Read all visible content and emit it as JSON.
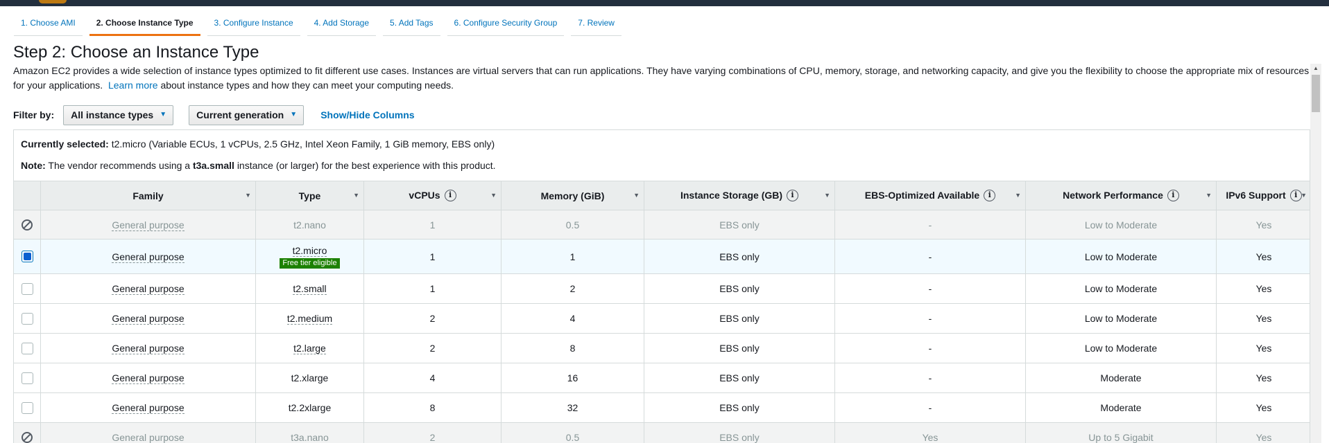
{
  "wizard": {
    "steps": [
      {
        "label": "1. Choose AMI"
      },
      {
        "label": "2. Choose Instance Type"
      },
      {
        "label": "3. Configure Instance"
      },
      {
        "label": "4. Add Storage"
      },
      {
        "label": "5. Add Tags"
      },
      {
        "label": "6. Configure Security Group"
      },
      {
        "label": "7. Review"
      }
    ],
    "active_index": 1
  },
  "page": {
    "title": "Step 2: Choose an Instance Type",
    "intro_part1": "Amazon EC2 provides a wide selection of instance types optimized to fit different use cases. Instances are virtual servers that can run applications. They have varying combinations of CPU, memory, storage, and networking capacity, and give you the flexibility to choose the appropriate mix of resources for your applications.",
    "learn_more": "Learn more",
    "intro_part2": "about instance types and how they can meet your computing needs."
  },
  "filter": {
    "label": "Filter by:",
    "types_value": "All instance types",
    "generation_value": "Current generation",
    "show_hide": "Show/Hide Columns"
  },
  "selection": {
    "label": "Currently selected:",
    "value": "t2.micro (Variable ECUs, 1 vCPUs, 2.5 GHz, Intel Xeon Family, 1 GiB memory, EBS only)",
    "note_label": "Note:",
    "note_pre": "The vendor recommends using a",
    "note_type": "t3a.small",
    "note_post": "instance (or larger) for the best experience with this product."
  },
  "table": {
    "headers": {
      "family": "Family",
      "type": "Type",
      "vcpus": "vCPUs",
      "memory": "Memory (GiB)",
      "storage": "Instance Storage (GB)",
      "ebs": "EBS-Optimized Available",
      "network": "Network Performance",
      "ipv6": "IPv6 Support"
    },
    "badge": "Free tier eligible",
    "rows": [
      {
        "state": "disabled",
        "family": "General purpose",
        "type": "t2.nano",
        "vcpus": "1",
        "memory": "0.5",
        "storage": "EBS only",
        "ebs": "-",
        "network": "Low to Moderate",
        "ipv6": "Yes"
      },
      {
        "state": "selected",
        "family": "General purpose",
        "type": "t2.micro",
        "vcpus": "1",
        "memory": "1",
        "storage": "EBS only",
        "ebs": "-",
        "network": "Low to Moderate",
        "ipv6": "Yes"
      },
      {
        "state": "normal",
        "family": "General purpose",
        "type": "t2.small",
        "vcpus": "1",
        "memory": "2",
        "storage": "EBS only",
        "ebs": "-",
        "network": "Low to Moderate",
        "ipv6": "Yes"
      },
      {
        "state": "normal",
        "family": "General purpose",
        "type": "t2.medium",
        "vcpus": "2",
        "memory": "4",
        "storage": "EBS only",
        "ebs": "-",
        "network": "Low to Moderate",
        "ipv6": "Yes"
      },
      {
        "state": "normal",
        "family": "General purpose",
        "type": "t2.large",
        "vcpus": "2",
        "memory": "8",
        "storage": "EBS only",
        "ebs": "-",
        "network": "Low to Moderate",
        "ipv6": "Yes"
      },
      {
        "state": "normal",
        "family": "General purpose",
        "type": "t2.xlarge",
        "vcpus": "4",
        "memory": "16",
        "storage": "EBS only",
        "ebs": "-",
        "network": "Moderate",
        "ipv6": "Yes"
      },
      {
        "state": "normal",
        "family": "General purpose",
        "type": "t2.2xlarge",
        "vcpus": "8",
        "memory": "32",
        "storage": "EBS only",
        "ebs": "-",
        "network": "Moderate",
        "ipv6": "Yes"
      },
      {
        "state": "disabled",
        "family": "General purpose",
        "type": "t3a.nano",
        "vcpus": "2",
        "memory": "0.5",
        "storage": "EBS only",
        "ebs": "Yes",
        "network": "Up to 5 Gigabit",
        "ipv6": "Yes"
      }
    ]
  }
}
